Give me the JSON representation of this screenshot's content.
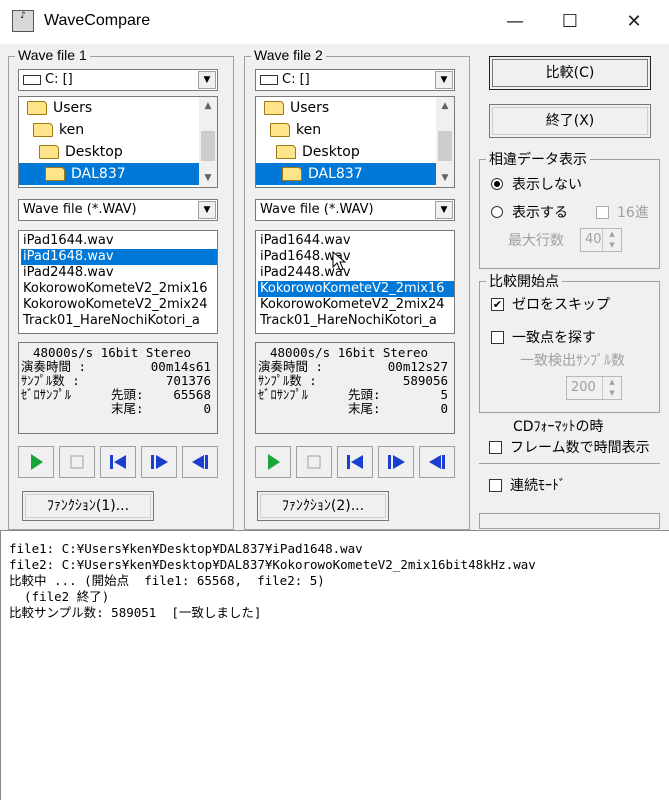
{
  "window": {
    "title": "WaveCompare",
    "minimize": "—",
    "maximize": "☐",
    "close": "✕"
  },
  "panel1": {
    "title": "Wave file 1",
    "drive": "C: []",
    "dirs": [
      "Users",
      "ken",
      "Desktop",
      "DAL837"
    ],
    "filter": "Wave file (*.WAV)",
    "files": [
      "iPad1644.wav",
      "iPad1648.wav",
      "iPad2448.wav",
      "KokorowoKometeV2_2mix16",
      "KokorowoKometeV2_2mix24",
      "Track01_HareNochiKotori_a"
    ],
    "selected_file_index": 1,
    "info": {
      "format": "48000s/s 16bit Stereo",
      "duration_label": "演奏時間 :",
      "duration": "00m14s61",
      "samples_label": "ｻﾝﾌﾟﾙ数 :",
      "samples": "701376",
      "zero_label": "ｾﾞﾛｻﾝﾌﾟﾙ",
      "head_label": "先頭:",
      "head": "65568",
      "tail_label": "末尾:",
      "tail": "0"
    },
    "function_button": "ﾌｧﾝｸｼｮﾝ(1)..."
  },
  "panel2": {
    "title": "Wave file 2",
    "drive": "C: []",
    "dirs": [
      "Users",
      "ken",
      "Desktop",
      "DAL837"
    ],
    "filter": "Wave file (*.WAV)",
    "files": [
      "iPad1644.wav",
      "iPad1648.wav",
      "iPad2448.wav",
      "KokorowoKometeV2_2mix16",
      "KokorowoKometeV2_2mix24",
      "Track01_HareNochiKotori_a"
    ],
    "selected_file_index": 3,
    "info": {
      "format": "48000s/s 16bit Stereo",
      "duration_label": "演奏時間 :",
      "duration": "00m12s27",
      "samples_label": "ｻﾝﾌﾟﾙ数 :",
      "samples": "589056",
      "zero_label": "ｾﾞﾛｻﾝﾌﾟﾙ",
      "head_label": "先頭:",
      "head": "5",
      "tail_label": "末尾:",
      "tail": "0"
    },
    "function_button": "ﾌｧﾝｸｼｮﾝ(2)..."
  },
  "right": {
    "compare_button": "比較(C)",
    "exit_button": "終了(X)",
    "diff_group_title": "相違データ表示",
    "radio_hide": "表示しない",
    "radio_show": "表示する",
    "hex_check": "16進",
    "max_rows_label": "最大行数",
    "max_rows_value": "40",
    "start_group_title": "比較開始点",
    "skip_zero": "ゼロをスキップ",
    "find_match": "一致点を探す",
    "match_samples_label": "一致検出ｻﾝﾌﾟﾙ数",
    "match_samples_value": "200",
    "cd_format_label": "CDﾌｫｰﾏｯﾄの時",
    "frame_display": "フレーム数で時間表示",
    "continuous_mode": "連続ﾓｰﾄﾞ"
  },
  "log": [
    "file1: C:¥Users¥ken¥Desktop¥DAL837¥iPad1648.wav",
    "file2: C:¥Users¥ken¥Desktop¥DAL837¥KokorowoKometeV2_2mix16bit48kHz.wav",
    "比較中 ... (開始点  file1: 65568,  file2: 5)",
    "  (file2 終了)",
    "比較サンプル数: 589051  [一致しました]"
  ],
  "colors": {
    "selection": "#0078d7",
    "play_green": "#1aa53a",
    "transport_blue": "#1a3fd0"
  }
}
